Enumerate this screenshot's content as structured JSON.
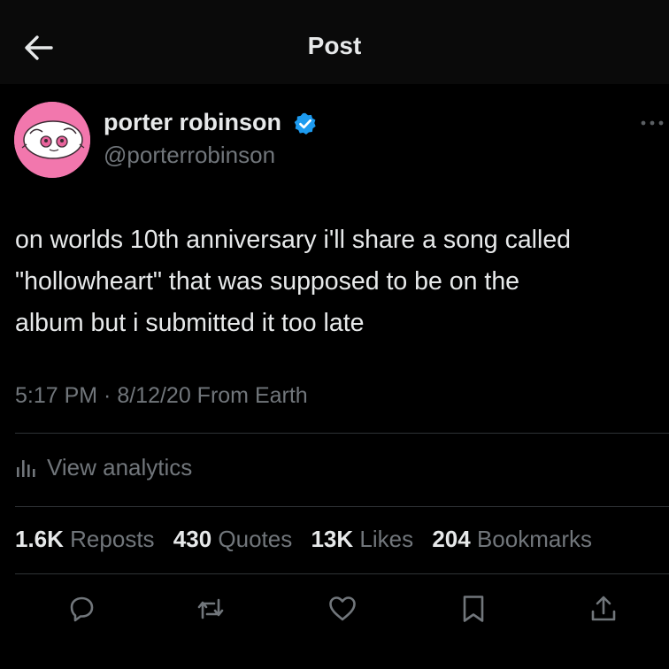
{
  "header": {
    "title": "Post",
    "back_icon": "arrow-left-icon"
  },
  "author": {
    "display_name": "porter robinson",
    "handle": "@porterrobinson",
    "verified_icon": "verified-badge-icon",
    "avatar_bg": "#f277ad",
    "verified_color": "#1d9bf0"
  },
  "post": {
    "text": "on worlds 10th anniversary i'll share a song called\n\"hollowheart\" that was supposed to be on the\nalbum but i submitted it too late",
    "meta": "5:17 PM · 8/12/20 From Earth"
  },
  "analytics": {
    "label": "View analytics",
    "icon": "bar-chart-icon"
  },
  "stats": [
    {
      "count": "1.6K",
      "label": "Reposts"
    },
    {
      "count": "430",
      "label": "Quotes"
    },
    {
      "count": "13K",
      "label": "Likes"
    },
    {
      "count": "204",
      "label": "Bookmarks"
    }
  ],
  "actions": [
    {
      "icon": "reply-icon"
    },
    {
      "icon": "repost-icon"
    },
    {
      "icon": "like-icon"
    },
    {
      "icon": "bookmark-icon"
    },
    {
      "icon": "share-icon"
    }
  ],
  "colors": {
    "background": "#000000",
    "primary_text": "#e7e9ea",
    "secondary_text": "#71767b",
    "divider": "#2f3336"
  }
}
